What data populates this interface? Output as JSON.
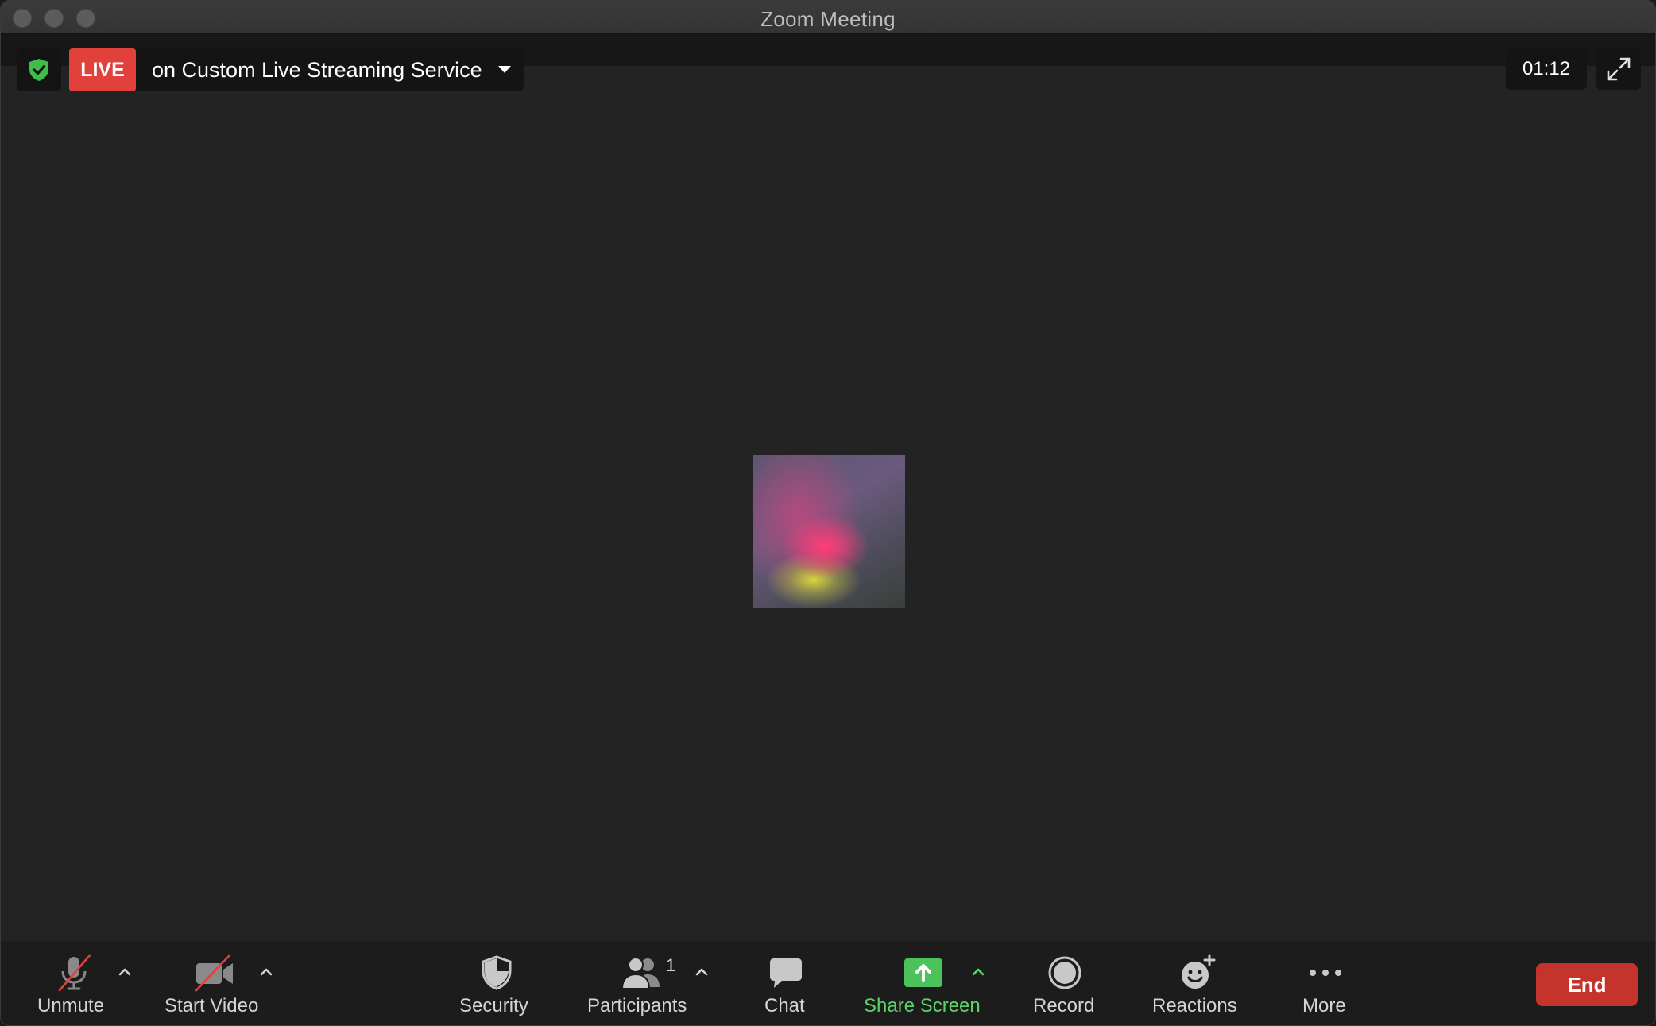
{
  "window": {
    "title": "Zoom Meeting"
  },
  "stream": {
    "live_label": "LIVE",
    "service_text": "on Custom Live Streaming Service",
    "timer": "01:12"
  },
  "toolbar": {
    "unmute_label": "Unmute",
    "start_video_label": "Start Video",
    "security_label": "Security",
    "participants_label": "Participants",
    "participants_count": "1",
    "chat_label": "Chat",
    "share_screen_label": "Share Screen",
    "record_label": "Record",
    "reactions_label": "Reactions",
    "more_label": "More",
    "end_label": "End"
  },
  "colors": {
    "live_red": "#e2403a",
    "share_green": "#5ed26a",
    "end_red": "#c5332d",
    "shield_green": "#3fbf4a"
  },
  "icons": {
    "encryption": "shield-check-icon",
    "fullscreen": "expand-icon",
    "unmute": "microphone-muted-icon",
    "start_video": "video-camera-off-icon",
    "security": "shield-icon",
    "participants": "people-icon",
    "chat": "chat-bubble-icon",
    "share_screen": "share-screen-icon",
    "record": "record-icon",
    "reactions": "emoji-add-icon",
    "more": "ellipsis-icon"
  }
}
